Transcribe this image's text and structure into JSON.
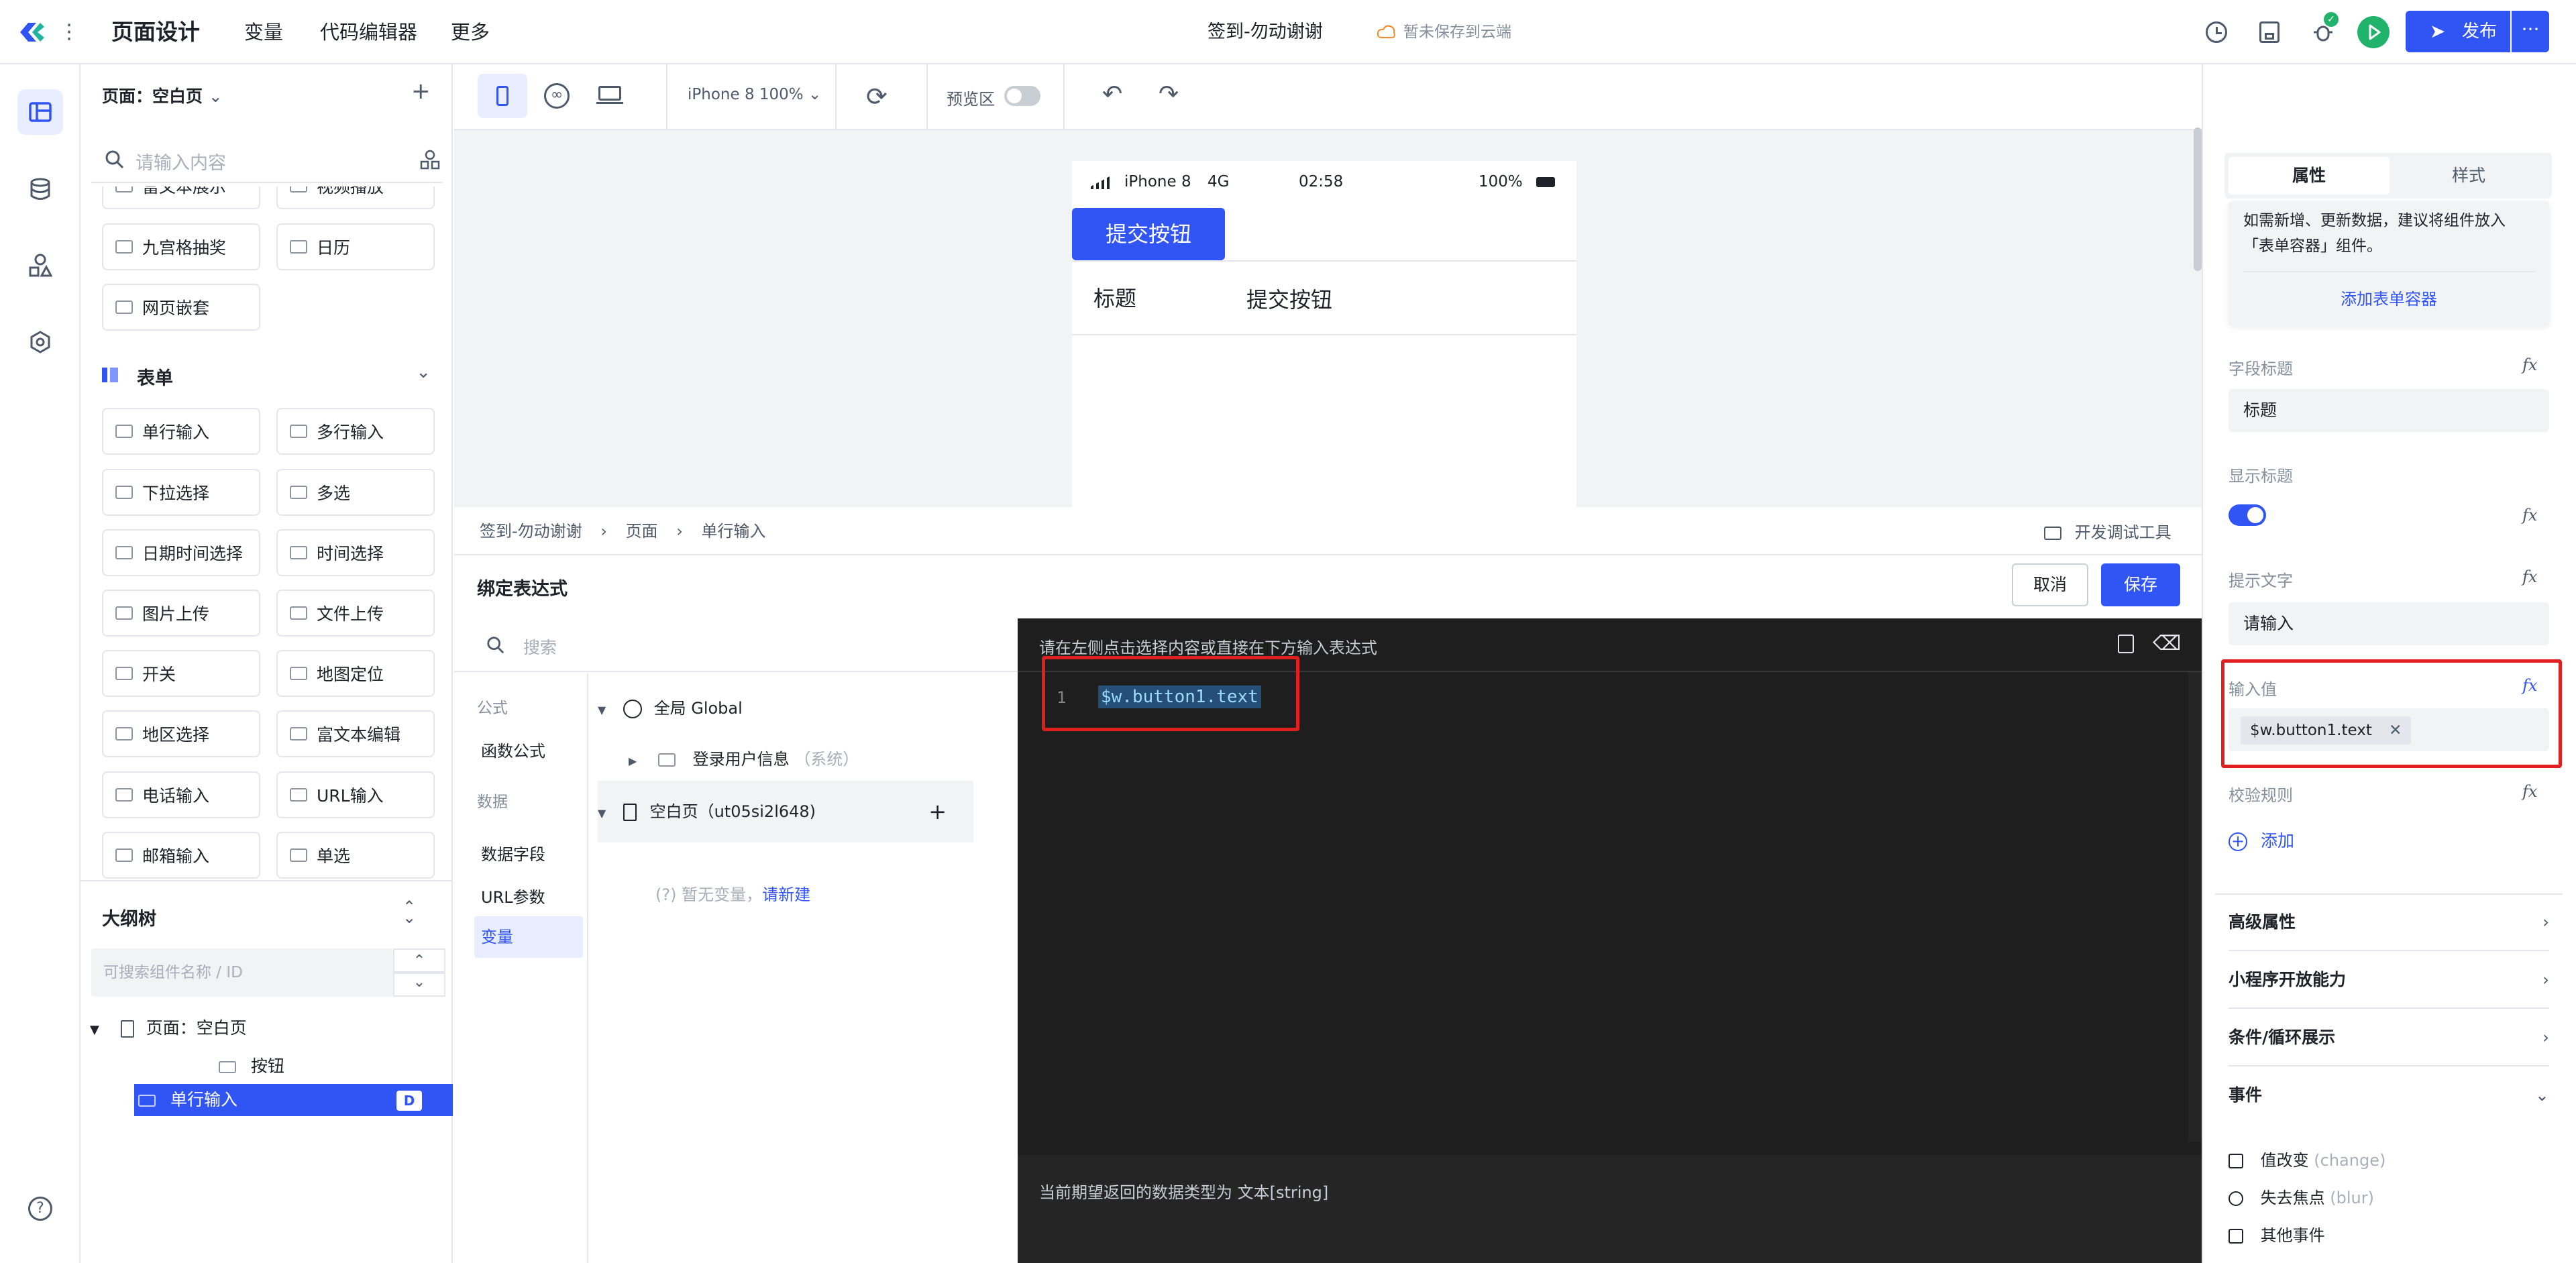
{
  "header": {
    "title": "页面设计",
    "nav": [
      "变量",
      "代码编辑器",
      "更多"
    ],
    "app_name": "签到-勿动谢谢",
    "save_status": "暂未保存到云端",
    "publish_label": "发布"
  },
  "components": {
    "page_label": "页面：空白页",
    "search_placeholder": "请输入内容",
    "media_items": [
      "富文本展示",
      "视频播放",
      "九宫格抽奖",
      "日历",
      "网页嵌套"
    ],
    "form_section_title": "表单",
    "form_items": [
      "单行输入",
      "多行输入",
      "下拉选择",
      "多选",
      "日期时间选择",
      "时间选择",
      "图片上传",
      "文件上传",
      "开关",
      "地图定位",
      "地区选择",
      "富文本编辑",
      "电话输入",
      "URL输入",
      "邮箱输入",
      "单选"
    ]
  },
  "outline": {
    "title": "大纲树",
    "search_placeholder": "可搜索组件名称 / ID",
    "root": "页面：空白页",
    "children": [
      "按钮",
      "单行输入"
    ],
    "selected_badge": "D"
  },
  "toolbar": {
    "device": "iPhone 8 100%",
    "preview_label": "预览区"
  },
  "phone": {
    "carrier": "iPhone 8",
    "network": "4G",
    "time": "02:58",
    "battery": "100%",
    "button_label": "提交按钮",
    "field_label": "标题",
    "field_value": "提交按钮"
  },
  "breadcrumb": {
    "items": [
      "签到-勿动谢谢",
      "页面",
      "单行输入"
    ],
    "dev_tools": "开发调试工具"
  },
  "bind_panel": {
    "title": "绑定表达式",
    "cancel_label": "取消",
    "save_label": "保存",
    "search_placeholder": "搜索",
    "categories": {
      "formula_header": "公式",
      "formula_item": "函数公式",
      "data_header": "数据",
      "data_items": [
        "数据字段",
        "URL参数",
        "变量"
      ]
    },
    "tree": {
      "global": "全局 Global",
      "login_info": "登录用户信息",
      "login_info_tag": "（系统）",
      "page": "空白页（ut05si2l648)",
      "no_var": "暂无变量，",
      "new_link": "请新建"
    },
    "editor_hint": "请在左侧点击选择内容或直接在下方输入表达式",
    "line_number": "1",
    "expression": "$w.button1.text",
    "return_type_hint": "当前期望返回的数据类型为 文本[string]"
  },
  "properties": {
    "tabs": [
      "属性",
      "样式"
    ],
    "info_text": "如需新增、更新数据，建议将组件放入「表单容器」组件。",
    "add_form_container": "添加表单容器",
    "field_title_label": "字段标题",
    "field_title_value": "标题",
    "show_title_label": "显示标题",
    "show_title_on": true,
    "placeholder_label": "提示文字",
    "placeholder_value": "请输入",
    "input_value_label": "输入值",
    "input_value_tag": "$w.button1.text",
    "validation_label": "校验规则",
    "add_label": "添加",
    "sections": [
      "高级属性",
      "小程序开放能力",
      "条件/循环展示",
      "事件"
    ],
    "events": [
      {
        "name": "值改变",
        "code": "(change)"
      },
      {
        "name": "失去焦点",
        "code": "(blur)"
      },
      {
        "name": "其他事件",
        "code": ""
      }
    ]
  },
  "colors": {
    "primary": "#3155f5",
    "highlight_red": "#e02020",
    "editor_bg": "#1e1e1e"
  }
}
